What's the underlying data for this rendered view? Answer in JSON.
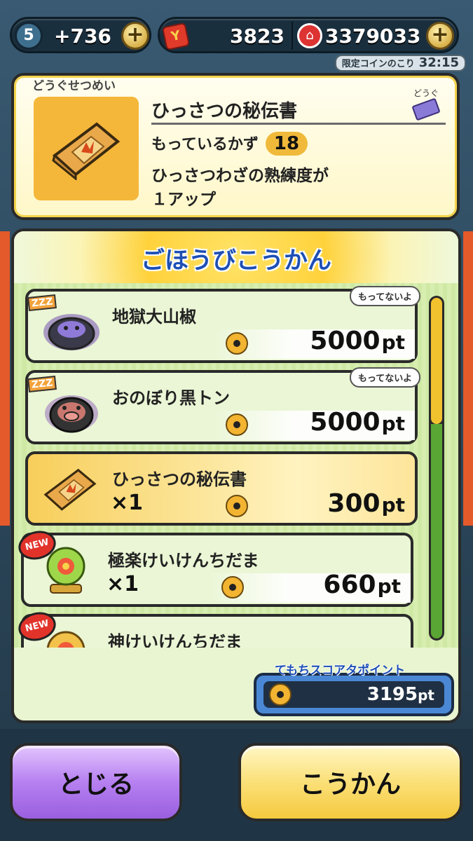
{
  "topbar": {
    "energy_level": "5",
    "energy_value": "+736",
    "coin_value": "3823",
    "money_value": "3379033",
    "plus_label": "+",
    "timer_label": "限定コインのこり",
    "timer_value": "32:15"
  },
  "description": {
    "tab_label": "どうぐせつめい",
    "item_name": "ひっさつの秘伝書",
    "category_tag": "どうぐ",
    "own_label": "もっているかず",
    "own_count": "18",
    "text_line1": "ひっさつわざの熟練度が",
    "text_line2": "１アップ"
  },
  "reward": {
    "title": "ごほうびこうかん",
    "items": [
      {
        "name": "地獄大山椒",
        "qty": "",
        "price": "5000",
        "unit": "pt",
        "badge": "もってないよ",
        "tag": "ZZZ",
        "icon": "purple-yokai-icon"
      },
      {
        "name": "おのぼり黒トン",
        "qty": "",
        "price": "5000",
        "unit": "pt",
        "badge": "もってないよ",
        "tag": "ZZZ",
        "icon": "boar-yokai-icon"
      },
      {
        "name": "ひっさつの秘伝書",
        "qty": "×1",
        "price": "300",
        "unit": "pt",
        "badge": "",
        "tag": "",
        "icon": "book-icon"
      },
      {
        "name": "極楽けいけんちだま",
        "qty": "×1",
        "price": "660",
        "unit": "pt",
        "badge": "",
        "tag": "NEW",
        "icon": "exp-orb-icon"
      },
      {
        "name": "神けいけんちだま",
        "qty": "",
        "price": "",
        "unit": "",
        "badge": "",
        "tag": "NEW",
        "icon": "exp-orb-icon"
      }
    ],
    "scroll_position": 0.0,
    "my_points_label": "てもちスコアタポイント",
    "my_points_value": "3195",
    "my_points_unit": "pt"
  },
  "buttons": {
    "close": "とじる",
    "exchange": "こうかん"
  },
  "colors": {
    "accent_blue": "#1d4fb4",
    "close_button": "#b680f0",
    "exchange_button": "#fbe078"
  }
}
